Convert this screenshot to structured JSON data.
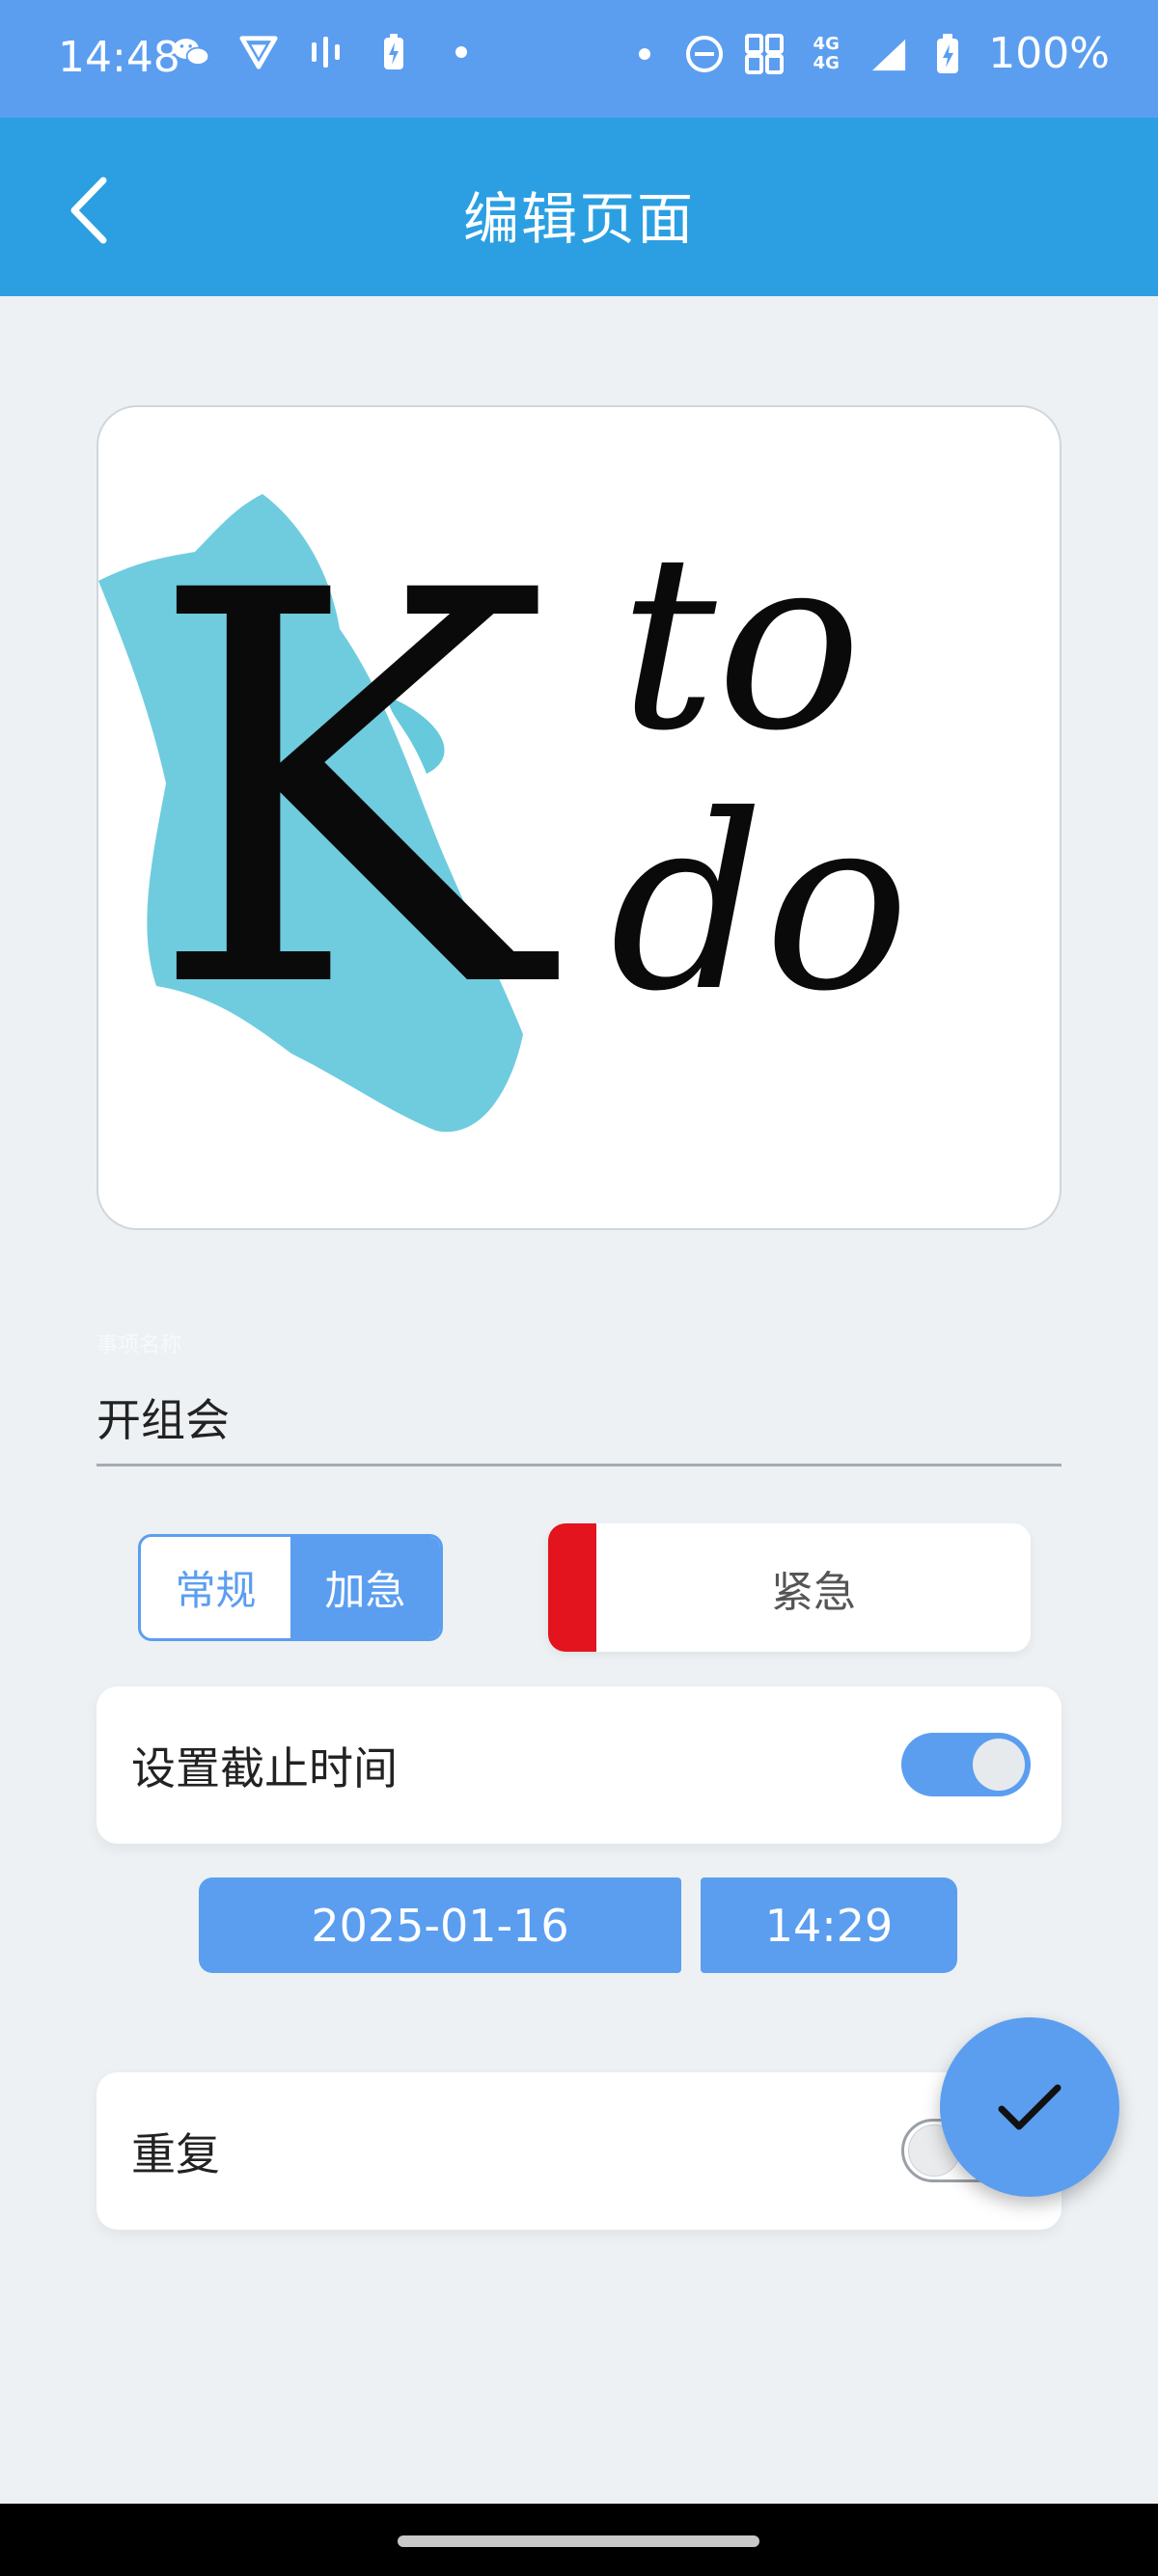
{
  "status_bar": {
    "time": "14:48",
    "battery_text": "100%",
    "network_label_top": "4G",
    "network_label_bottom": "4G"
  },
  "app_bar": {
    "title": "编辑页面",
    "back_icon": "chevron-left-icon"
  },
  "logo": {
    "letter_k": "K",
    "line1": "to",
    "line2": "do",
    "accent_color": "#67c9dc"
  },
  "task": {
    "title_hint": "事项名称",
    "title_value": "开组会"
  },
  "priority": {
    "options": [
      "常规",
      "加急"
    ],
    "selected": "加急",
    "level_label": "紧急",
    "level_color": "#e3141d"
  },
  "deadline": {
    "label": "设置截止时间",
    "enabled": true,
    "date": "2025-01-16",
    "time": "14:29"
  },
  "repeat": {
    "label": "重复",
    "enabled": false
  },
  "fab": {
    "icon": "check-icon"
  },
  "colors": {
    "status_bar": "#5b9ef0",
    "app_bar": "#2b9fe2",
    "accent": "#5b9ef0",
    "background": "#edf1f4"
  }
}
